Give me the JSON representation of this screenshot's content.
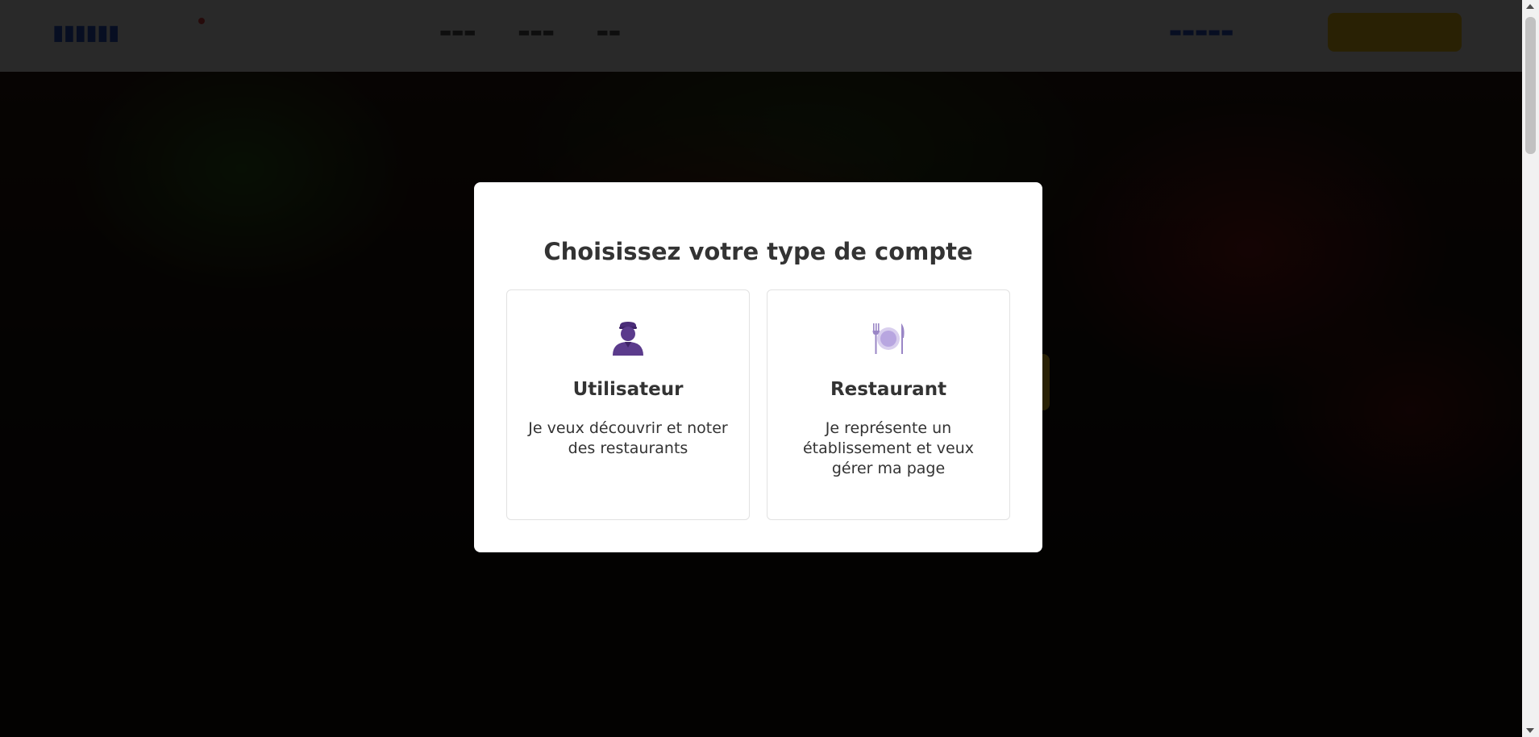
{
  "colors": {
    "brand_blue": "#2c55c9",
    "accent_yellow": "#f4c21a",
    "icon_purple": "#5b3b8c",
    "overlay": "rgba(0,0,0,0.83)"
  },
  "modal": {
    "title": "Choisissez votre type de compte",
    "options": [
      {
        "icon": "user-icon",
        "title": "Utilisateur",
        "description": "Je veux découvrir et noter des restaurants"
      },
      {
        "icon": "plate-cutlery-icon",
        "title": "Restaurant",
        "description": "Je représente un établissement et veux gérer ma page"
      }
    ]
  }
}
